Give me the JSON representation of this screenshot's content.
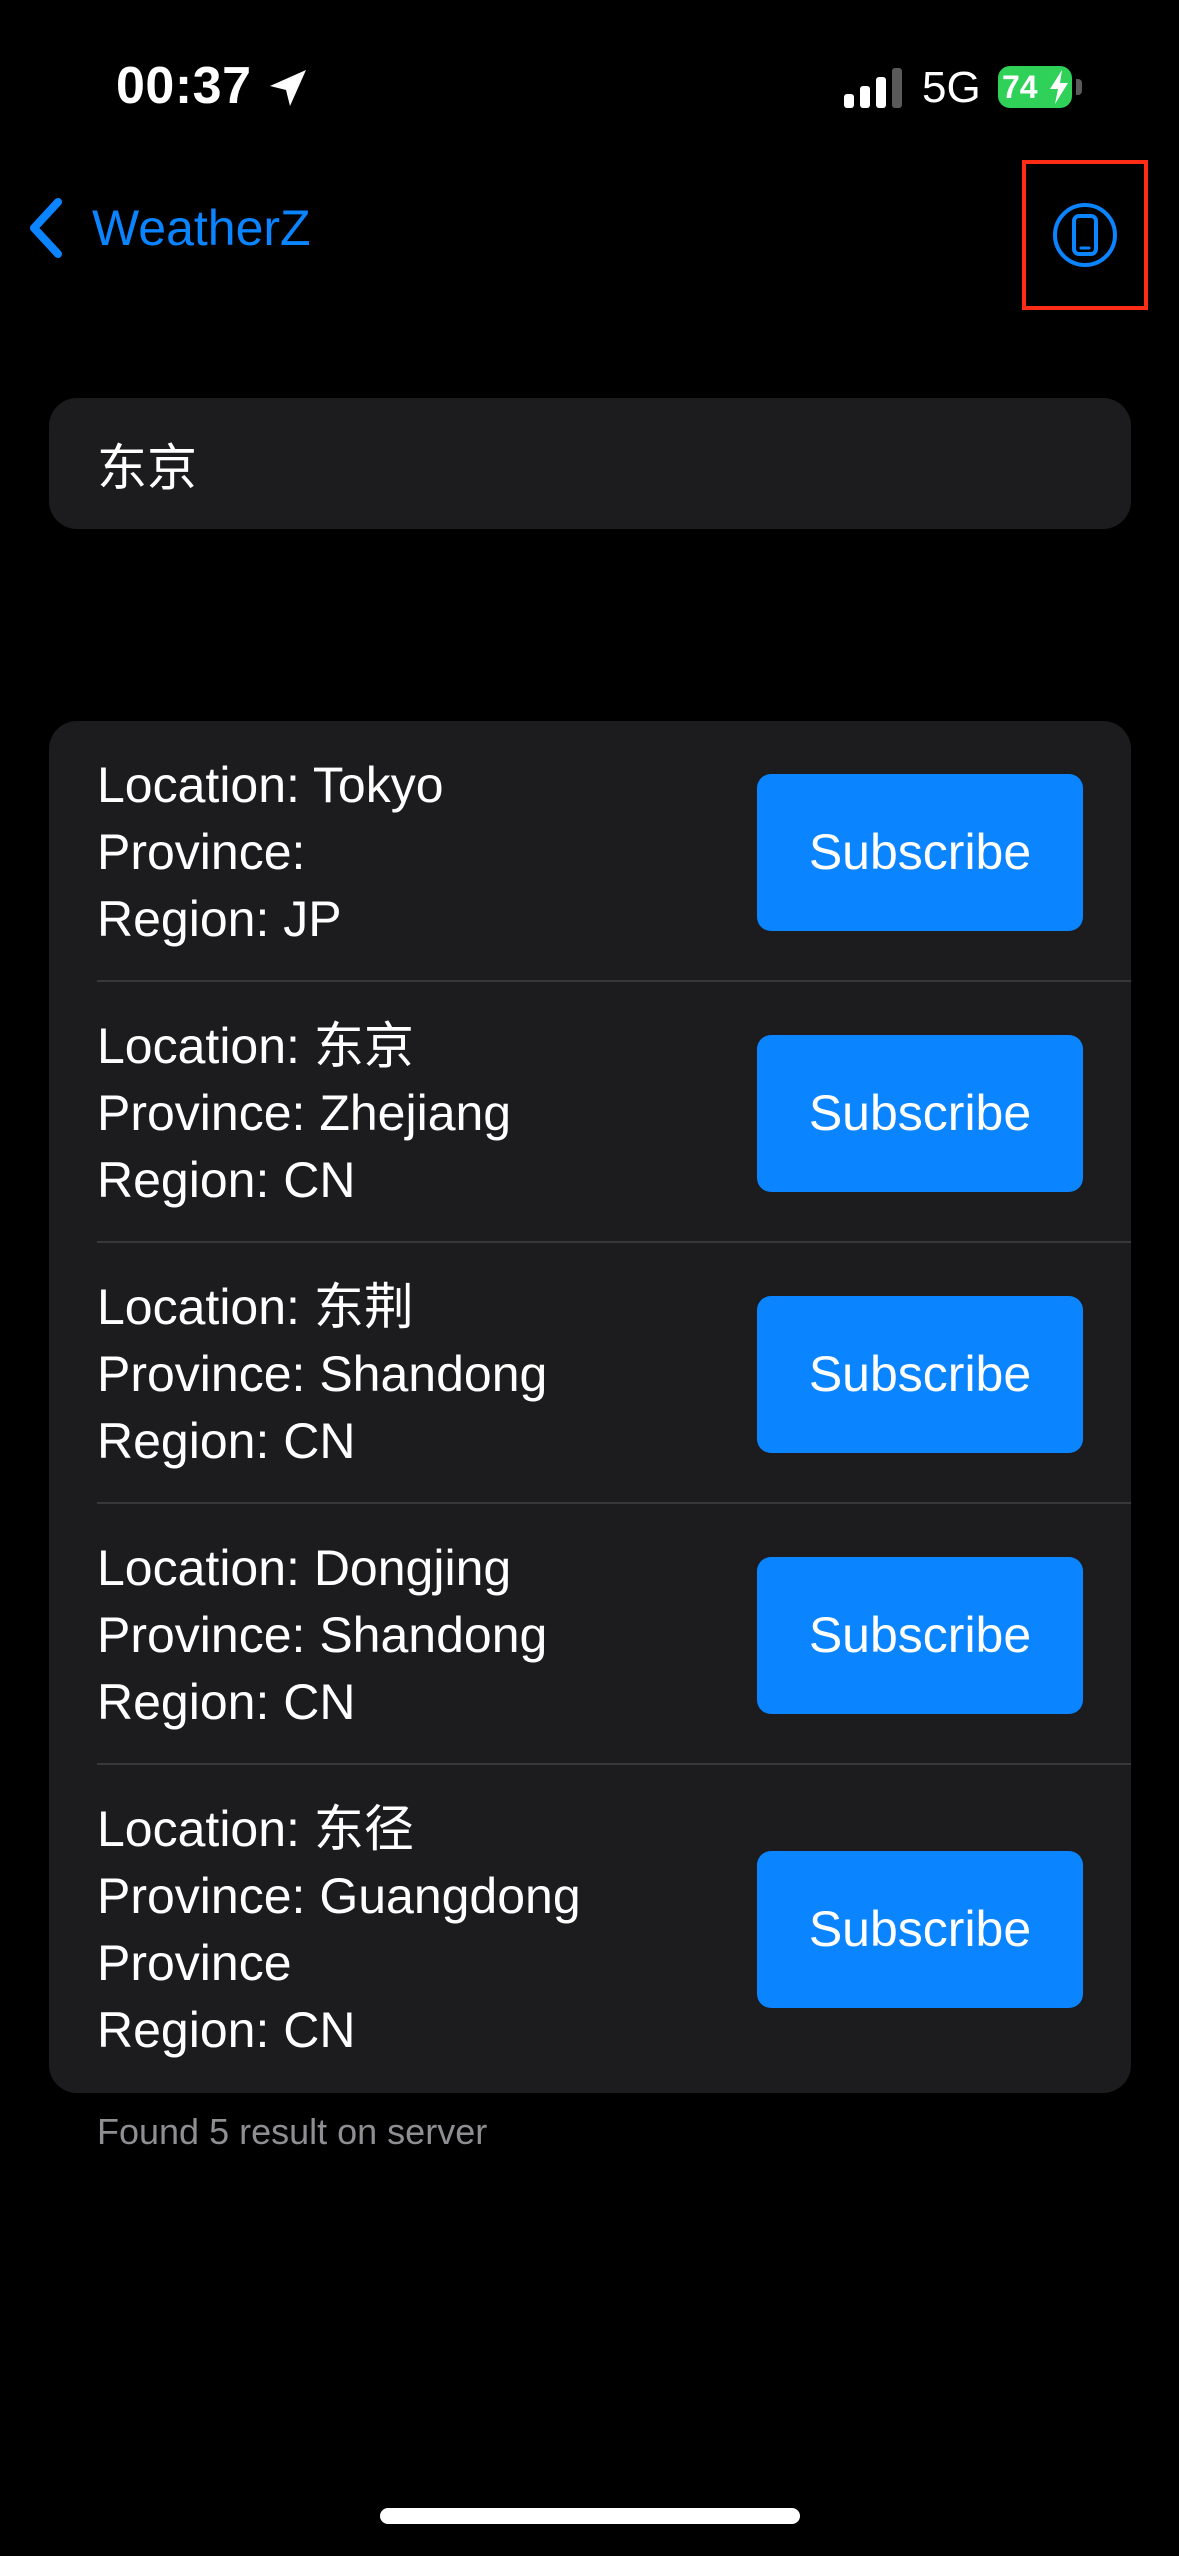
{
  "status_bar": {
    "time": "00:37",
    "network": "5G",
    "battery": "74"
  },
  "nav": {
    "back_label": "WeatherZ"
  },
  "search": {
    "value": "东京"
  },
  "results": [
    {
      "location": "Location: Tokyo",
      "province": "Province:",
      "region": "Region: JP",
      "button": "Subscribe"
    },
    {
      "location": "Location: 东京",
      "province": "Province: Zhejiang",
      "region": "Region: CN",
      "button": "Subscribe"
    },
    {
      "location": "Location: 东荆",
      "province": "Province: Shandong",
      "region": "Region: CN",
      "button": "Subscribe"
    },
    {
      "location": "Location: Dongjing",
      "province": "Province: Shandong",
      "region": "Region: CN",
      "button": "Subscribe"
    },
    {
      "location": "Location: 东径",
      "province": "Province: Guangdong Province",
      "region": "Region: CN",
      "button": "Subscribe"
    }
  ],
  "footer": {
    "note": "Found 5 result on server"
  },
  "colors": {
    "accent": "#0a84ff",
    "background": "#000000",
    "card": "#1c1c1e",
    "battery": "#30d158",
    "highlight_box": "#ff2d16"
  }
}
